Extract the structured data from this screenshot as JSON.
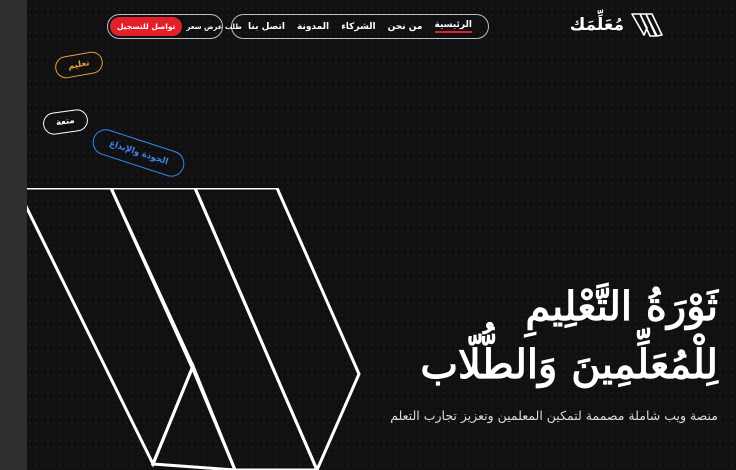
{
  "brand": {
    "name": "مُعَلِّمَك"
  },
  "nav": {
    "items": [
      {
        "label": "الرئيسية",
        "active": true
      },
      {
        "label": "من نحن",
        "active": false
      },
      {
        "label": "الشركاء",
        "active": false
      },
      {
        "label": "المدونة",
        "active": false
      },
      {
        "label": "اتصل بنا",
        "active": false
      }
    ]
  },
  "cta": {
    "register": "تواصل للتسجيل",
    "quote": "طلب عرض سعر"
  },
  "tags": {
    "education": "تعليم",
    "fun": "متعة",
    "quality": "الجودة والإبداع"
  },
  "hero": {
    "title_line1": "ثَوْرَةُ التَّعْلِيمِ",
    "title_line2": "لِلْمُعَلِّمِينَ وَالطُّلّاب",
    "subtitle": "منصة ويب شاملة مصممة لتمكين المعلمين وتعزيز تجارب التعلم"
  },
  "colors": {
    "accent": "#e3202a",
    "background": "#101012",
    "tag_orange": "#e8a13a",
    "tag_blue": "#3a86e8"
  },
  "icons": {
    "logo": "brand-m-mark-icon",
    "hero_graphic": "brand-m-mark-large"
  }
}
